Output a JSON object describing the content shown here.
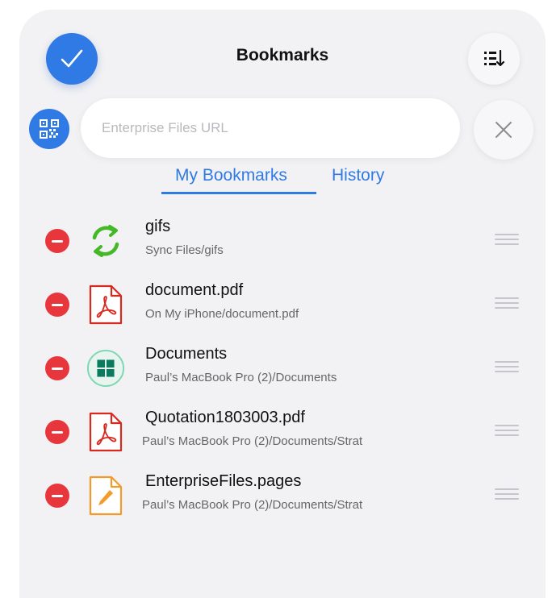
{
  "header": {
    "title": "Bookmarks"
  },
  "url_bar": {
    "placeholder": "Enterprise Files URL",
    "value": ""
  },
  "tabs": [
    {
      "label": "My Bookmarks",
      "active": true
    },
    {
      "label": "History",
      "active": false
    }
  ],
  "bookmarks": [
    {
      "name": "gifs",
      "path": "Sync Files/gifs",
      "icon": "sync-folder-icon"
    },
    {
      "name": "document.pdf",
      "path": "On My iPhone/document.pdf",
      "icon": "pdf-icon"
    },
    {
      "name": "Documents",
      "path": "Paul’s MacBook Pro (2)/Documents",
      "icon": "windows-folder-icon"
    },
    {
      "name": "Quotation1803003.pdf",
      "path": "Paul’s MacBook Pro (2)/Documents/Strat",
      "icon": "pdf-icon"
    },
    {
      "name": "EnterpriseFiles.pages",
      "path": "Paul’s MacBook Pro (2)/Documents/Strat",
      "icon": "pages-icon"
    }
  ],
  "colors": {
    "accent": "#2f7ae5",
    "delete": "#e8363d",
    "sync_green": "#44b827",
    "pdf_red": "#d8291f",
    "windows_teal": "#0b7a5f",
    "pages_orange": "#f39a2a"
  }
}
